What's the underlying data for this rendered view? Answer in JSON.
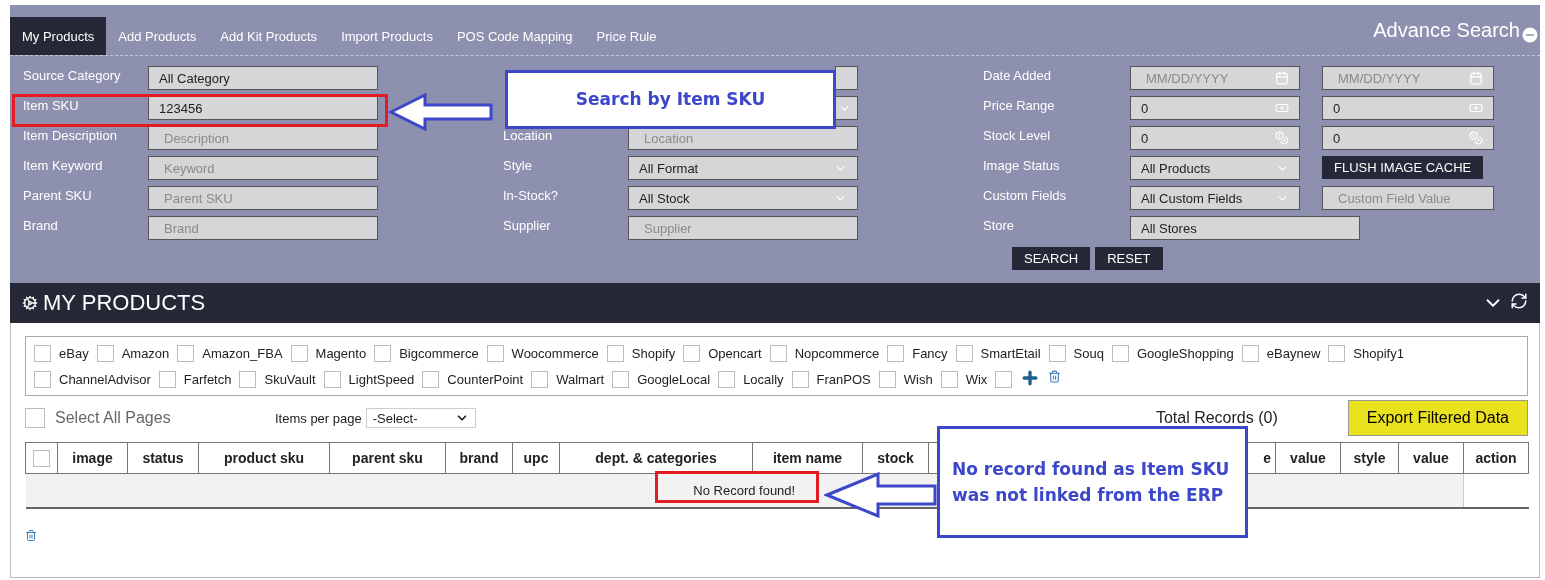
{
  "tabs": [
    {
      "label": "My Products",
      "selected": true
    },
    {
      "label": "Add Products",
      "selected": false
    },
    {
      "label": "Add Kit Products",
      "selected": false
    },
    {
      "label": "Import Products",
      "selected": false
    },
    {
      "label": "POS Code Mapping",
      "selected": false
    },
    {
      "label": "Price Rule",
      "selected": false
    }
  ],
  "advance_search": {
    "title": "Advance Search"
  },
  "filters_left": [
    {
      "label": "Source Category",
      "kind": "input",
      "value": "All Category"
    },
    {
      "label": "Item SKU",
      "kind": "input",
      "value": "123456"
    },
    {
      "label": "Item Description",
      "kind": "input",
      "placeholder": "Description"
    },
    {
      "label": "Item Keyword",
      "kind": "input",
      "placeholder": "Keyword"
    },
    {
      "label": "Parent SKU",
      "kind": "input",
      "placeholder": "Parent SKU"
    },
    {
      "label": "Brand",
      "kind": "input",
      "placeholder": "Brand"
    }
  ],
  "filters_middle": [
    {
      "kind": "input",
      "partial": true
    },
    {
      "kind": "select",
      "partial": true
    },
    {
      "label": "Location",
      "kind": "input",
      "placeholder": "Location"
    },
    {
      "label": "Style",
      "kind": "select",
      "value": "All Format"
    },
    {
      "label": "In-Stock?",
      "kind": "select",
      "value": "All Stock"
    },
    {
      "label": "Supplier",
      "kind": "input",
      "placeholder": "Supplier"
    }
  ],
  "filters_right": [
    {
      "label": "Date Added",
      "fields": [
        {
          "kind": "date",
          "placeholder": "MM/DD/YYYY"
        },
        {
          "kind": "date",
          "placeholder": "MM/DD/YYYY"
        }
      ]
    },
    {
      "label": "Price Range",
      "fields": [
        {
          "kind": "price",
          "value": "0"
        },
        {
          "kind": "price",
          "value": "0"
        }
      ]
    },
    {
      "label": "Stock Level",
      "fields": [
        {
          "kind": "quantity",
          "value": "0"
        },
        {
          "kind": "quantity",
          "value": "0"
        }
      ]
    },
    {
      "label": "Image Status",
      "fields": [
        {
          "kind": "select",
          "value": "All Products"
        },
        {
          "kind": "button",
          "label": "FLUSH IMAGE CACHE"
        }
      ]
    },
    {
      "label": "Custom Fields",
      "fields": [
        {
          "kind": "select",
          "value": "All Custom Fields"
        },
        {
          "kind": "input",
          "placeholder": "Custom Field Value"
        }
      ]
    },
    {
      "label": "Store",
      "fields": [
        {
          "kind": "input",
          "value": "All Stores"
        }
      ]
    }
  ],
  "search_buttons": [
    "SEARCH",
    "RESET"
  ],
  "panel": {
    "title": "MY PRODUCTS"
  },
  "channels": [
    {
      "label": "eBay",
      "checked": false
    },
    {
      "label": "Amazon",
      "checked": false
    },
    {
      "label": "Amazon_FBA",
      "checked": false
    },
    {
      "label": "Magento",
      "checked": false
    },
    {
      "label": "Bigcommerce",
      "checked": false
    },
    {
      "label": "Woocommerce",
      "checked": false
    },
    {
      "label": "Shopify",
      "checked": false
    },
    {
      "label": "Opencart",
      "checked": false
    },
    {
      "label": "Nopcommerce",
      "checked": false
    },
    {
      "label": "Fancy",
      "checked": false
    },
    {
      "label": "SmartEtail",
      "checked": false
    },
    {
      "label": "Souq",
      "checked": false
    },
    {
      "label": "GoogleShopping",
      "checked": false
    },
    {
      "label": "eBaynew",
      "checked": false
    },
    {
      "label": "Shopify1",
      "checked": false
    },
    {
      "label": "ChannelAdvisor",
      "checked": false
    },
    {
      "label": "Farfetch",
      "checked": false
    },
    {
      "label": "SkuVault",
      "checked": false
    },
    {
      "label": "LightSpeed",
      "checked": false
    },
    {
      "label": "CounterPoint",
      "checked": false
    },
    {
      "label": "Walmart",
      "checked": false
    },
    {
      "label": "GoogleLocal",
      "checked": false
    },
    {
      "label": "Locally",
      "checked": false
    },
    {
      "label": "FranPOS",
      "checked": false
    },
    {
      "label": "Wish",
      "checked": false
    },
    {
      "label": "Wix",
      "checked": false
    },
    {
      "checked": false
    }
  ],
  "select_all_pages": {
    "label": "Select All Pages",
    "checked": false
  },
  "items_per_page": {
    "label": "Items per page",
    "value": "-Select-"
  },
  "total_records": "Total Records (0)",
  "export_button": "Export Filtered Data",
  "table": {
    "select_all_checked": false,
    "columns": [
      "image",
      "status",
      "product sku",
      "parent sku",
      "brand",
      "upc",
      "dept. & categories",
      "item name",
      "stock",
      "e",
      "value",
      "style",
      "value",
      "action"
    ],
    "empty_message": "No Record found!"
  },
  "annotations": [
    {
      "text": "Search by Item SKU"
    },
    {
      "text": "No record found as Item SKU was not linked from the ERP"
    }
  ]
}
